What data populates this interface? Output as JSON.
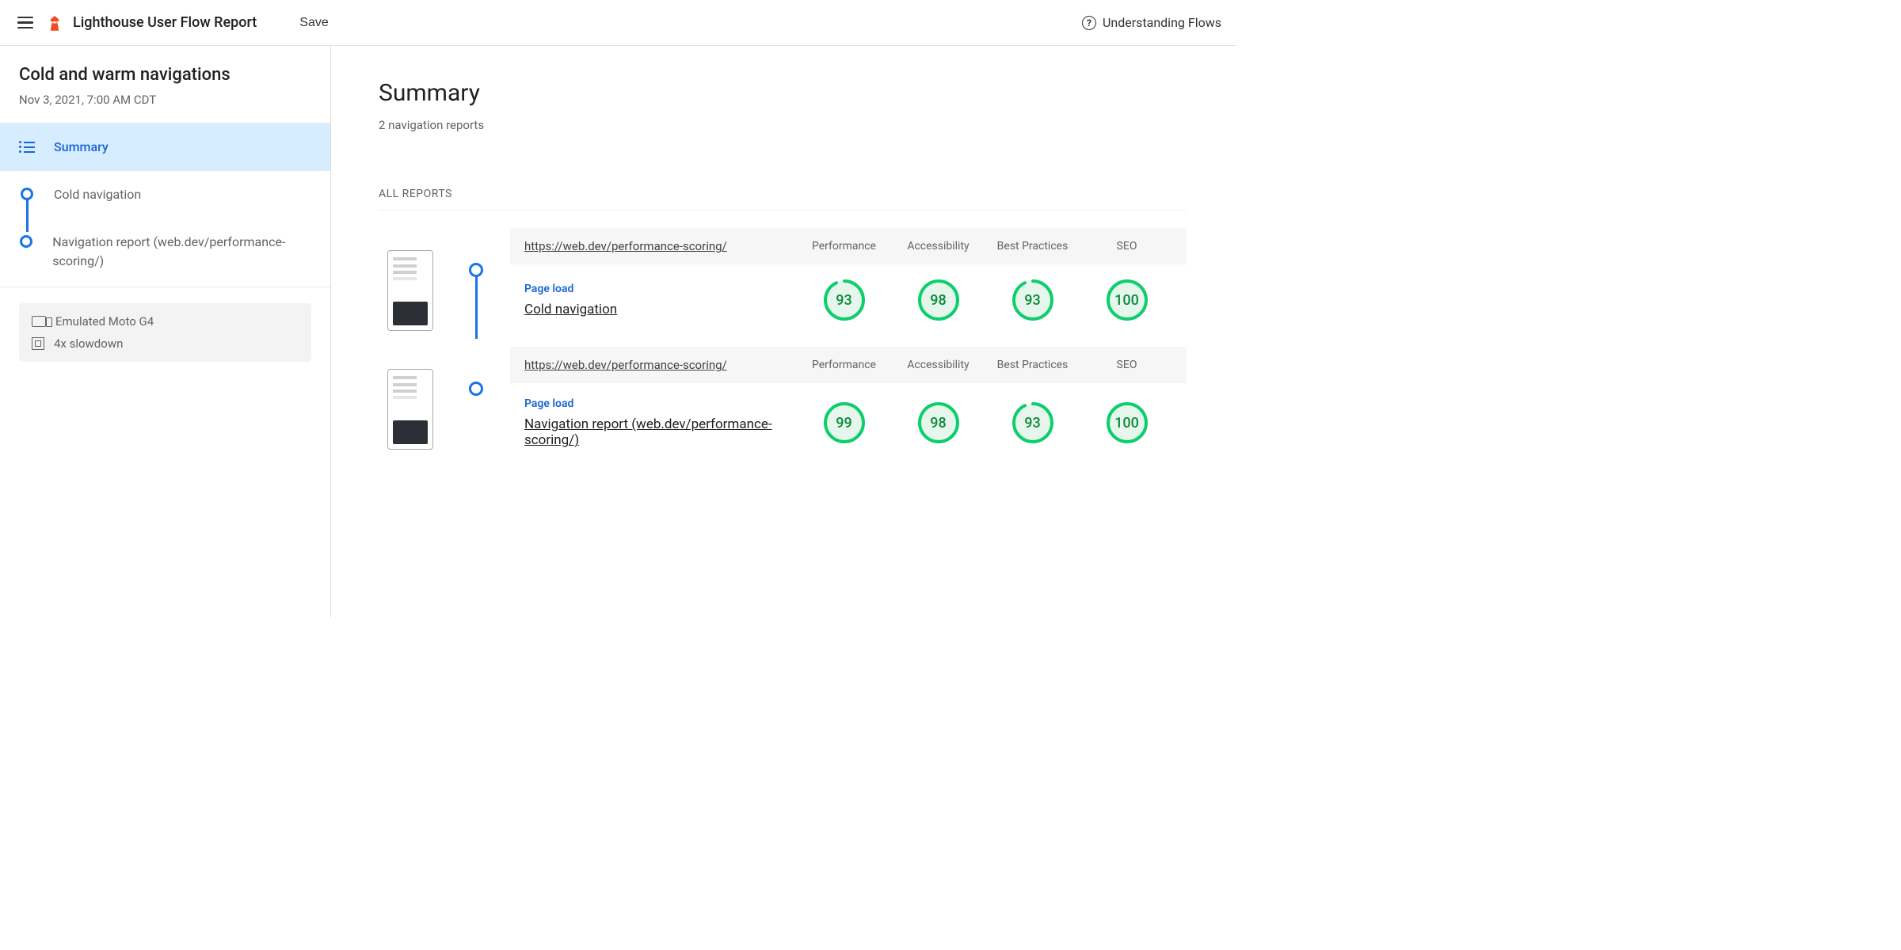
{
  "topbar": {
    "app_title": "Lighthouse User Flow Report",
    "save_label": "Save",
    "help_label": "Understanding Flows"
  },
  "sidebar": {
    "flow_title": "Cold and warm navigations",
    "flow_date": "Nov 3, 2021, 7:00 AM CDT",
    "summary_label": "Summary",
    "steps": [
      {
        "label": "Cold navigation"
      },
      {
        "label": "Navigation report (web.dev/performance-scoring/)"
      }
    ],
    "meta": {
      "device": "Emulated Moto G4",
      "cpu": "4x slowdown"
    }
  },
  "main": {
    "title": "Summary",
    "subtitle": "2 navigation reports",
    "all_reports_label": "ALL REPORTS",
    "col_labels": {
      "perf": "Performance",
      "a11y": "Accessibility",
      "bp": "Best Practices",
      "seo": "SEO"
    },
    "step_tag": "Page load",
    "reports": [
      {
        "url": "https://web.dev/performance-scoring/",
        "name": "Cold navigation",
        "scores": {
          "perf": 93,
          "a11y": 98,
          "bp": 93,
          "seo": 100
        }
      },
      {
        "url": "https://web.dev/performance-scoring/",
        "name": "Navigation report (web.dev/performance-scoring/)",
        "scores": {
          "perf": 99,
          "a11y": 98,
          "bp": 93,
          "seo": 100
        }
      }
    ]
  },
  "colors": {
    "accent": "#1a73e8",
    "pass": "#0cce6b"
  }
}
